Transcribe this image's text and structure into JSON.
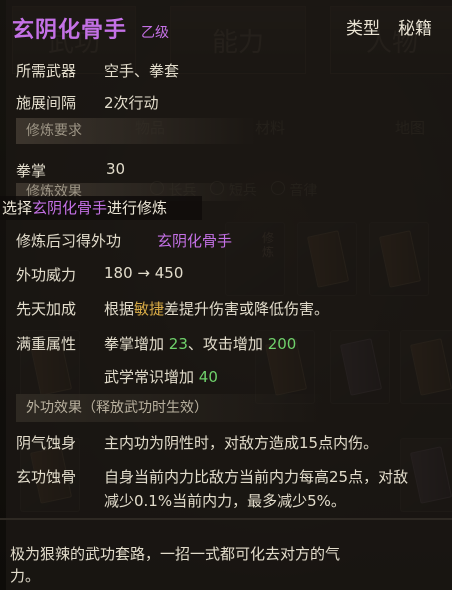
{
  "background": {
    "tabs": [
      "武功",
      "能力",
      "人物"
    ],
    "subtabs": [
      "物品",
      "材料",
      "地图"
    ],
    "radios": [
      "长兵",
      "短兵",
      "音律"
    ],
    "slot_text": "修炼"
  },
  "skill": {
    "name": "玄阴化骨手",
    "grade": "乙级",
    "type_label": "类型",
    "type_value": "秘籍"
  },
  "info": {
    "weapon_label": "所需武器",
    "weapon_value": "空手、拳套",
    "interval_label": "施展间隔",
    "interval_value": "2次行动"
  },
  "requirement": {
    "header": "修炼要求",
    "stat_label": "拳掌",
    "stat_value": "30"
  },
  "effect": {
    "header": "修炼效果",
    "prompt_prefix": "选择",
    "prompt_skill": "玄阴化骨手",
    "prompt_suffix": "进行修炼",
    "learn_label": "修炼后习得外功",
    "learn_value": "玄阴化骨手",
    "power_label": "外功威力",
    "power_value": "180 → 450",
    "innate_label": "先天加成",
    "innate_prefix": "根据",
    "innate_stat": "敏捷",
    "innate_suffix": "差提升伤害或降低伤害。",
    "full_label": "满重属性",
    "full_line1_a": "拳掌增加",
    "full_line1_a_val": "23",
    "full_line1_b": "、攻击增加",
    "full_line1_b_val": "200",
    "full_line2_a": "武学常识增加",
    "full_line2_a_val": "40"
  },
  "outer_effect": {
    "header": "外功效果（释放武功时生效）",
    "items": [
      {
        "name": "阴气蚀身",
        "desc": "主内功为阴性时，对敌方造成15点内伤。"
      },
      {
        "name": "玄功蚀骨",
        "desc_line1": "自身当前内力比敌方当前内力每高25点，对敌",
        "desc_line2": "减少0.1%当前内力，最多减少5%。"
      }
    ]
  },
  "description_line1": "极为狠辣的武功套路，一招一式都可化去对方的气",
  "description_line2": "力。"
}
